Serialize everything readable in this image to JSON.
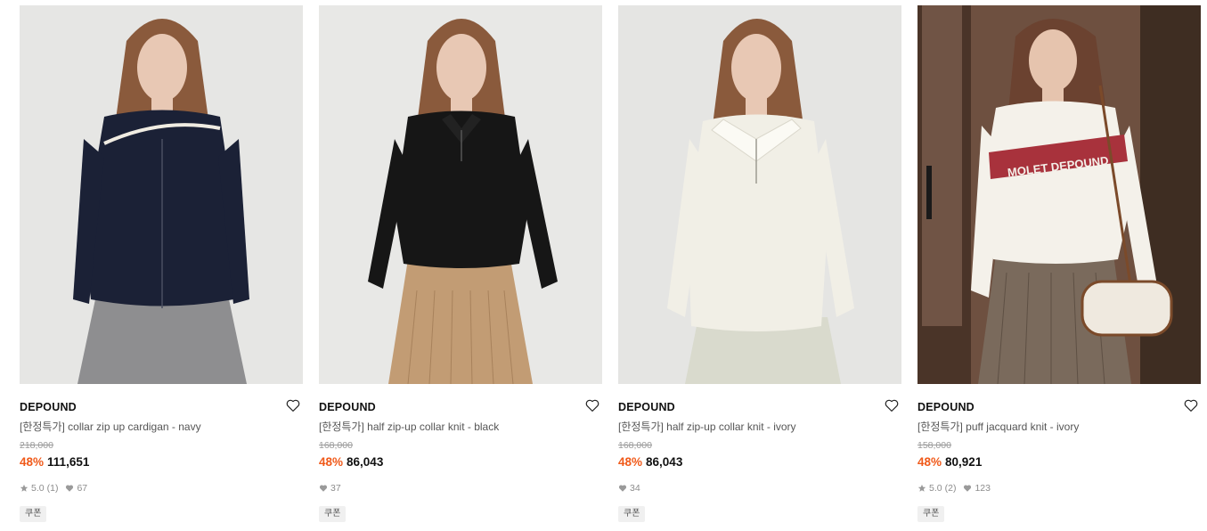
{
  "products": [
    {
      "brand": "DEPOUND",
      "title": "[한정특가] collar zip up cardigan - navy",
      "original_price": "218,000",
      "discount": "48%",
      "sale_price": "111,651",
      "rating": "5.0",
      "reviews": "(1)",
      "likes": "67",
      "badge": "쿠폰",
      "image": {
        "bg": "#e6e6e4",
        "top": "#1b2136",
        "bottom": "#8e8e90",
        "hair": "#8a5a3c",
        "skin": "#e8c8b4"
      }
    },
    {
      "brand": "DEPOUND",
      "title": "[한정특가] half zip-up collar knit - black",
      "original_price": "168,000",
      "discount": "48%",
      "sale_price": "86,043",
      "likes": "37",
      "badge": "쿠폰",
      "image": {
        "bg": "#e8e8e6",
        "top": "#161616",
        "bottom": "#c29c74",
        "hair": "#8a5a3c",
        "skin": "#e8c8b4"
      }
    },
    {
      "brand": "DEPOUND",
      "title": "[한정특가] half zip-up collar knit - ivory",
      "original_price": "168,000",
      "discount": "48%",
      "sale_price": "86,043",
      "likes": "34",
      "badge": "쿠폰",
      "image": {
        "bg": "#e5e5e3",
        "top": "#f1efe6",
        "bottom": "#d9dacd",
        "hair": "#8a5a3c",
        "skin": "#e8c8b4"
      }
    },
    {
      "brand": "DEPOUND",
      "title": "[한정특가] puff jacquard knit - ivory",
      "original_price": "158,000",
      "discount": "48%",
      "sale_price": "80,921",
      "rating": "5.0",
      "reviews": "(2)",
      "likes": "123",
      "badge": "쿠폰",
      "image": {
        "bg": "#6e5040",
        "top": "#f4f1ea",
        "bottom": "#7a6a5c",
        "hair": "#6b4230",
        "skin": "#e6c4ae",
        "stripe": "#a8323c",
        "stripe_text": "MOLET DEPOUND"
      }
    }
  ],
  "icons": {
    "heart_outline": "heart-outline-icon",
    "heart_filled": "heart-filled-icon",
    "star": "star-icon"
  },
  "colors": {
    "discount": "#f05a1a",
    "text": "#111111",
    "muted": "#9a9a9a"
  }
}
